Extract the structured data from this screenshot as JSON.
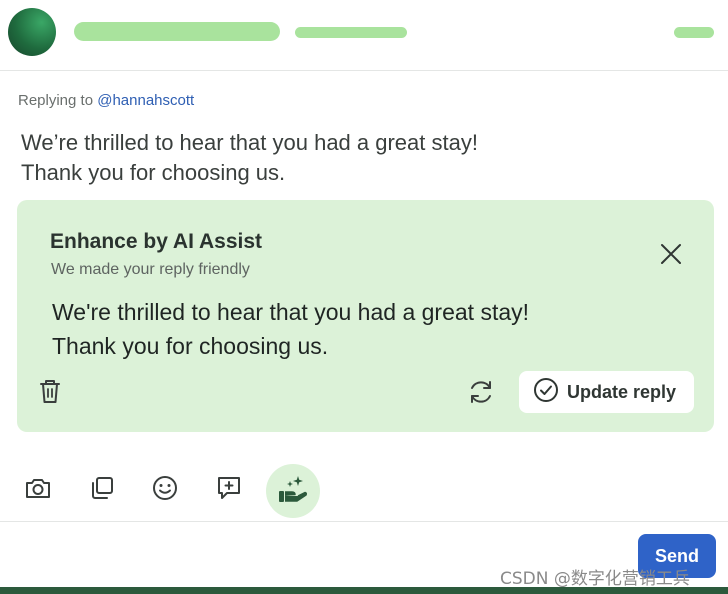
{
  "reply_context": {
    "prefix": "Replying to",
    "handle": "@hannahscott"
  },
  "draft": {
    "lines": [
      "We’re thrilled to hear that you had a great stay!",
      "Thank you for choosing us."
    ]
  },
  "ai_assist": {
    "title": "Enhance by AI Assist",
    "subtitle": "We made your reply friendly",
    "suggestion_lines": [
      "We're thrilled to hear that you had a great stay!",
      "Thank you for choosing us."
    ],
    "update_label": "Update reply"
  },
  "toolbar": {
    "icons": [
      "camera-icon",
      "copy-icon",
      "emoji-icon",
      "comment-plus-icon",
      "ai-assist-hand-sparkle-icon"
    ]
  },
  "composer": {
    "send_label": "Send"
  },
  "watermark": "CSDN @数字化营销工兵",
  "colors": {
    "accent_green_light": "#dcf2d8",
    "placeholder_green": "#a9e39d",
    "link_blue": "#2f5fb3",
    "send_blue": "#2f63c8",
    "bottom_bar": "#2c5a3c"
  }
}
